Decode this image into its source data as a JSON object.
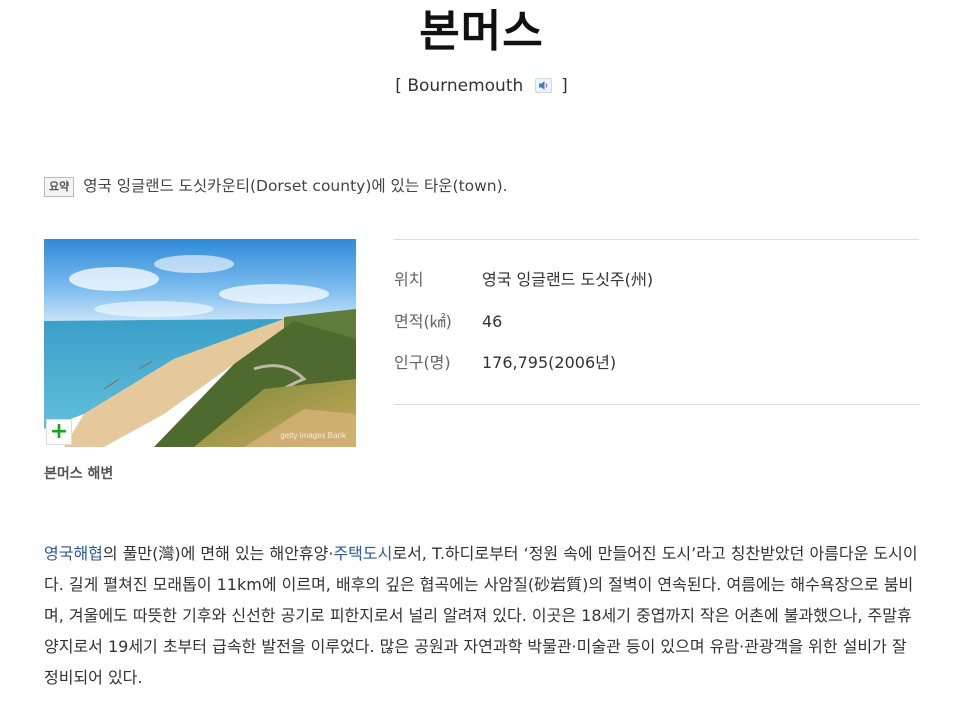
{
  "entry": {
    "title": "본머스",
    "english_name": "Bournemouth",
    "bracket_open": "[",
    "bracket_close": "]",
    "speaker_icon": "speaker-icon"
  },
  "summary": {
    "badge": "요약",
    "text": "영국 잉글랜드 도싯카운티(Dorset county)에 있는 타운(town)."
  },
  "photo": {
    "caption": "본머스 해변",
    "zoom_icon": "plus-icon",
    "zoom_color": "#1aa31a",
    "watermark": "getty images Bank"
  },
  "info": {
    "rows": [
      {
        "key": "위치",
        "value": "영국 잉글랜드 도싯주(州)"
      },
      {
        "key": "면적(㎢)",
        "value": "46"
      },
      {
        "key": "인구(명)",
        "value": "176,795(2006년)"
      }
    ]
  },
  "body": {
    "link1": "영국해협",
    "seg1": "의 풀만(灣)에 면해 있는 해안휴양·",
    "link2": "주택도시",
    "seg2": "로서, T.하디로부터 ‘정원 속에 만들어진 도시’라고 칭찬받았던 아름다운 도시이다. 길게 펼쳐진 모래톱이 11km에 이르며, 배후의 깊은 협곡에는 사암질(砂岩質)의 절벽이 연속된다. 여름에는 해수욕장으로 붐비며, 겨울에도 따뜻한 기후와 신선한 공기로 피한지로서 널리 알려져 있다. 이곳은 18세기 중엽까지 작은 어촌에 불과했으나, 주말휴양지로서 19세기 초부터 급속한 발전을 이루었다. 많은 공원과 자연과학 박물관·미술관 등이 있으며 유람·관광객을 위한 설비가 잘 정비되어 있다.",
    "link_color": "#2c5aa0"
  }
}
